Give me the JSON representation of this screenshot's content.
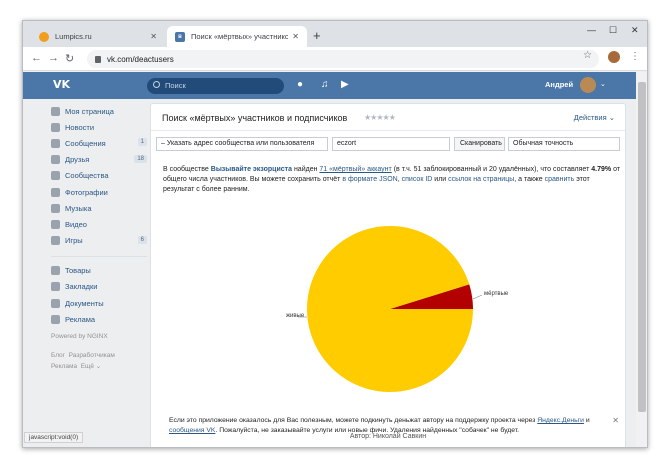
{
  "browser": {
    "tabs": [
      {
        "title": "Lumpics.ru",
        "active": false
      },
      {
        "title": "Поиск «мёртвых» участников и",
        "active": true
      }
    ],
    "new_tab": "+",
    "url": "vk.com/deactusers",
    "window_controls": [
      "—",
      "☐",
      "✕"
    ]
  },
  "vk_header": {
    "logo": "VK",
    "search_placeholder": "Поиск",
    "user_name": "Андрей"
  },
  "sidebar": {
    "items": [
      {
        "label": "Моя страница",
        "count": ""
      },
      {
        "label": "Новости",
        "count": ""
      },
      {
        "label": "Сообщения",
        "count": "1"
      },
      {
        "label": "Друзья",
        "count": "18"
      },
      {
        "label": "Сообщества",
        "count": ""
      },
      {
        "label": "Фотографии",
        "count": ""
      },
      {
        "label": "Музыка",
        "count": ""
      },
      {
        "label": "Видео",
        "count": ""
      },
      {
        "label": "Игры",
        "count": "6"
      }
    ],
    "items2": [
      {
        "label": "Товары"
      },
      {
        "label": "Закладки"
      },
      {
        "label": "Документы"
      },
      {
        "label": "Реклама"
      }
    ],
    "powered": "Powered by NGINX",
    "footer_links": [
      "Блог",
      "Разработчикам",
      "Реклама",
      "Ещё ⌄"
    ]
  },
  "app": {
    "title": "Поиск «мёртвых» участников и подписчиков",
    "stars": "★★★★★",
    "actions": "Действия ⌄",
    "source_select": "– Указать адрес сообщества или пользователя",
    "source_input": "eczort",
    "scan_button": "Сканировать",
    "accuracy_select": "Обычная точность",
    "result": {
      "p1": "В сообществе",
      "group": "Вызывайте экзорциста",
      "p2": "найден",
      "found": "71 «мёртвый» аккаунт",
      "p3": "(в т.ч. 51 заблокированный и 20 удалённых), что составляет",
      "percent": "4.79%",
      "p4": "от общего числа участников. Вы можете сохранить отчёт",
      "json": "в формате JSON",
      "ids": "список ID",
      "or": "или",
      "pages": "ссылок на страницы",
      "p5": ", а также",
      "compare": "сравнить",
      "p6": "этот результат с более ранним."
    },
    "notice": {
      "p1": "Если это приложение оказалось для Вас полезным, можете подкинуть деньжат автору на поддержку проекта через",
      "yandex": "Яндекс.Деньги",
      "and": "и",
      "vkmsg": "сообщения VK",
      "p2": ". Пожалуйста, не заказывайте услуги или новые фичи. Удаления найденных \"собачек\" не будет."
    },
    "author": "Автор: Николай Савкин"
  },
  "status_bar": "javascript:void(0)",
  "chart_data": {
    "type": "pie",
    "categories": [
      "мёртвые",
      "живые"
    ],
    "values": [
      4.79,
      95.21
    ],
    "colors": [
      "#b30000",
      "#ffcc00"
    ]
  }
}
